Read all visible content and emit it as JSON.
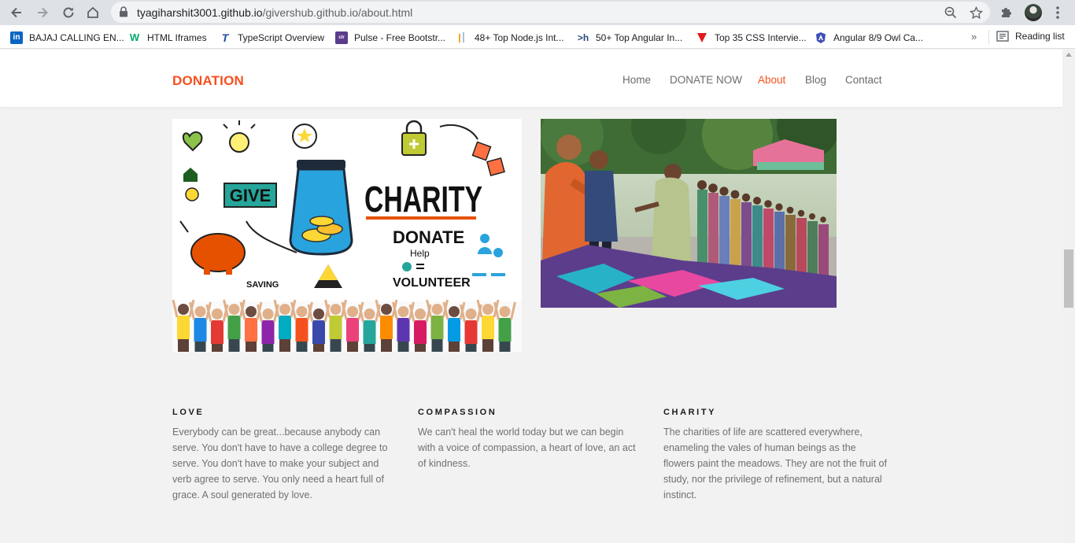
{
  "browser": {
    "url_host": "tyagiharshit3001.github.io",
    "url_path": "/givershub.github.io/about.html",
    "bookmarks": [
      {
        "label": "BAJAJ CALLING EN...",
        "icon": "linkedin-icon",
        "color": "#0a66c2"
      },
      {
        "label": "HTML Iframes",
        "icon": "w3schools-icon",
        "color": "#04aa6d"
      },
      {
        "label": "TypeScript Overview",
        "icon": "typescript-icon",
        "color": "#1c4c9c"
      },
      {
        "label": "Pulse - Free Bootstr...",
        "icon": "colorlib-icon",
        "color": "#5a3b8c"
      },
      {
        "label": "48+ Top Node.js Int...",
        "icon": "bars-icon",
        "color": "#f5a623"
      },
      {
        "label": "50+ Top Angular In...",
        "icon": "h-icon",
        "color": "#2b4c7e"
      },
      {
        "label": "Top 35 CSS Intervie...",
        "icon": "triangle-icon",
        "color": "#e0191b"
      },
      {
        "label": "Angular 8/9 Owl Ca...",
        "icon": "angular-icon",
        "color": "#3f51b5"
      }
    ],
    "more_label": "»",
    "reading_list_label": "Reading list"
  },
  "site": {
    "logo": "DONATION",
    "menu": [
      {
        "label": "Home",
        "active": false
      },
      {
        "label": "DONATE NOW",
        "active": false
      },
      {
        "label": "About",
        "active": true
      },
      {
        "label": "Blog",
        "active": false
      },
      {
        "label": "Contact",
        "active": false
      }
    ],
    "accent": "#f4511e"
  },
  "images": {
    "charity_graphic": {
      "words": [
        "GIVE",
        "CHARITY",
        "DONATE",
        "Help",
        "VOLUNTEER",
        "SAVING"
      ]
    },
    "distribution_photo": {}
  },
  "features": [
    {
      "title": "LOVE",
      "text": "Everybody can be great...because anybody can serve. You don't have to have a college degree to serve. You don't have to make your subject and verb agree to serve. You only need a heart full of grace. A soul generated by love."
    },
    {
      "title": "COMPASSION",
      "text": "We can't heal the world today but we can begin with a voice of compassion, a heart of love, an act of kindness."
    },
    {
      "title": "CHARITY",
      "text": "The charities of life are scattered everywhere, enameling the vales of human beings as the flowers paint the meadows. They are not the fruit of study, nor the privilege of refinement, but a natural instinct."
    }
  ]
}
